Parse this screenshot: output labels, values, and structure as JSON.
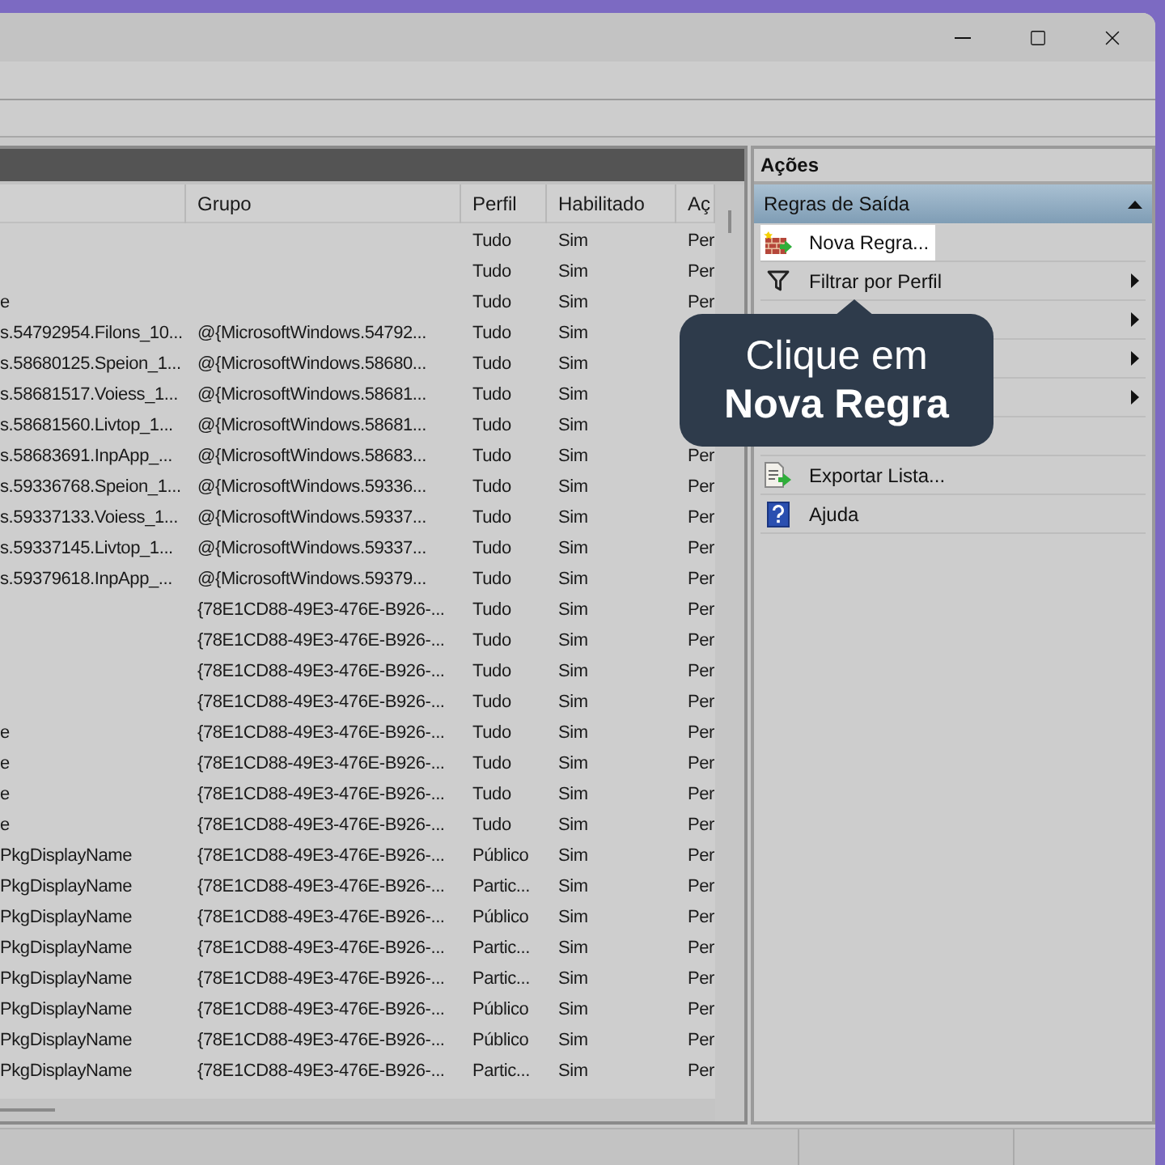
{
  "rules_table": {
    "columns": [
      "Grupo",
      "Perfil",
      "Habilitado",
      "Aç"
    ],
    "rows": [
      {
        "name": null,
        "group": null,
        "profile": "Tudo",
        "enabled": "Sim",
        "action": "Per"
      },
      {
        "name": null,
        "group": null,
        "profile": "Tudo",
        "enabled": "Sim",
        "action": "Per"
      },
      {
        "name": "e",
        "group": null,
        "profile": "Tudo",
        "enabled": "Sim",
        "action": "Per"
      },
      {
        "name": "s.54792954.Filons_10...",
        "group": "@{MicrosoftWindows.54792...",
        "profile": "Tudo",
        "enabled": "Sim",
        "action": null
      },
      {
        "name": "s.58680125.Speion_1...",
        "group": "@{MicrosoftWindows.58680...",
        "profile": "Tudo",
        "enabled": "Sim",
        "action": null
      },
      {
        "name": "s.58681517.Voiess_1...",
        "group": "@{MicrosoftWindows.58681...",
        "profile": "Tudo",
        "enabled": "Sim",
        "action": null
      },
      {
        "name": "s.58681560.Livtop_1...",
        "group": "@{MicrosoftWindows.58681...",
        "profile": "Tudo",
        "enabled": "Sim",
        "action": null
      },
      {
        "name": "s.58683691.InpApp_...",
        "group": "@{MicrosoftWindows.58683...",
        "profile": "Tudo",
        "enabled": "Sim",
        "action": "Per"
      },
      {
        "name": "s.59336768.Speion_1...",
        "group": "@{MicrosoftWindows.59336...",
        "profile": "Tudo",
        "enabled": "Sim",
        "action": "Per"
      },
      {
        "name": "s.59337133.Voiess_1...",
        "group": "@{MicrosoftWindows.59337...",
        "profile": "Tudo",
        "enabled": "Sim",
        "action": "Per"
      },
      {
        "name": "s.59337145.Livtop_1...",
        "group": "@{MicrosoftWindows.59337...",
        "profile": "Tudo",
        "enabled": "Sim",
        "action": "Per"
      },
      {
        "name": "s.59379618.InpApp_...",
        "group": "@{MicrosoftWindows.59379...",
        "profile": "Tudo",
        "enabled": "Sim",
        "action": "Per"
      },
      {
        "name": null,
        "group": "{78E1CD88-49E3-476E-B926-...",
        "profile": "Tudo",
        "enabled": "Sim",
        "action": "Per"
      },
      {
        "name": null,
        "group": "{78E1CD88-49E3-476E-B926-...",
        "profile": "Tudo",
        "enabled": "Sim",
        "action": "Per"
      },
      {
        "name": null,
        "group": "{78E1CD88-49E3-476E-B926-...",
        "profile": "Tudo",
        "enabled": "Sim",
        "action": "Per"
      },
      {
        "name": null,
        "group": "{78E1CD88-49E3-476E-B926-...",
        "profile": "Tudo",
        "enabled": "Sim",
        "action": "Per"
      },
      {
        "name": "e",
        "group": "{78E1CD88-49E3-476E-B926-...",
        "profile": "Tudo",
        "enabled": "Sim",
        "action": "Per"
      },
      {
        "name": "e",
        "group": "{78E1CD88-49E3-476E-B926-...",
        "profile": "Tudo",
        "enabled": "Sim",
        "action": "Per"
      },
      {
        "name": "e",
        "group": "{78E1CD88-49E3-476E-B926-...",
        "profile": "Tudo",
        "enabled": "Sim",
        "action": "Per"
      },
      {
        "name": "e",
        "group": "{78E1CD88-49E3-476E-B926-...",
        "profile": "Tudo",
        "enabled": "Sim",
        "action": "Per"
      },
      {
        "name": "PkgDisplayName",
        "group": "{78E1CD88-49E3-476E-B926-...",
        "profile": "Público",
        "enabled": "Sim",
        "action": "Per"
      },
      {
        "name": "PkgDisplayName",
        "group": "{78E1CD88-49E3-476E-B926-...",
        "profile": "Partic...",
        "enabled": "Sim",
        "action": "Per"
      },
      {
        "name": "PkgDisplayName",
        "group": "{78E1CD88-49E3-476E-B926-...",
        "profile": "Público",
        "enabled": "Sim",
        "action": "Per"
      },
      {
        "name": "PkgDisplayName",
        "group": "{78E1CD88-49E3-476E-B926-...",
        "profile": "Partic...",
        "enabled": "Sim",
        "action": "Per"
      },
      {
        "name": "PkgDisplayName",
        "group": "{78E1CD88-49E3-476E-B926-...",
        "profile": "Partic...",
        "enabled": "Sim",
        "action": "Per"
      },
      {
        "name": "PkgDisplayName",
        "group": "{78E1CD88-49E3-476E-B926-...",
        "profile": "Público",
        "enabled": "Sim",
        "action": "Per"
      },
      {
        "name": "PkgDisplayName",
        "group": "{78E1CD88-49E3-476E-B926-...",
        "profile": "Público",
        "enabled": "Sim",
        "action": "Per"
      },
      {
        "name": "PkgDisplayName",
        "group": "{78E1CD88-49E3-476E-B926-...",
        "profile": "Partic...",
        "enabled": "Sim",
        "action": "Per"
      }
    ]
  },
  "actions_pane": {
    "title": "Ações",
    "section": {
      "label": "Regras de Saída",
      "expanded": true
    },
    "items": [
      {
        "kind": "new-rule",
        "label": "Nova Regra...",
        "selected": true
      },
      {
        "kind": "filter",
        "label": "Filtrar por Perfil",
        "selected": false
      },
      {
        "kind": "submenu",
        "selected": false
      },
      {
        "kind": "submenu",
        "selected": false
      },
      {
        "kind": "submenu",
        "selected": false
      },
      {
        "kind": "blank",
        "selected": false
      },
      {
        "kind": "export",
        "label": "Exportar Lista...",
        "selected": false
      },
      {
        "kind": "help",
        "label": "Ajuda",
        "selected": false
      }
    ]
  },
  "callout": {
    "text": "Clique em **Nova Regra**"
  }
}
